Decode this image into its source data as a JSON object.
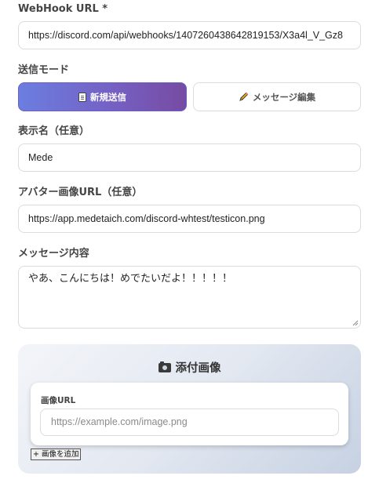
{
  "webhook": {
    "label": "WebHook URL *",
    "value": "https://discord.com/api/webhooks/1407260438642819153/X3a4l_V_Gz8"
  },
  "send_mode": {
    "label": "送信モード",
    "new_send": {
      "icon": "document-icon",
      "label": "新規送信",
      "active": true
    },
    "edit_message": {
      "icon": "pencil-icon",
      "label": "メッセージ編集",
      "active": false
    }
  },
  "display_name": {
    "label": "表示名（任意）",
    "value": "Mede"
  },
  "avatar_url": {
    "label": "アバター画像URL（任意）",
    "value": "https://app.medetaich.com/discord-whtest/testicon.png"
  },
  "message": {
    "label": "メッセージ内容",
    "value": "やあ、こんにちは！めでたいだよ！！！！！"
  },
  "attachments": {
    "title_icon": "camera-icon",
    "title": "添付画像",
    "items": [
      {
        "label": "画像URL",
        "placeholder": "https://example.com/image.png",
        "value": ""
      }
    ],
    "add_button_label": "+ 画像を追加"
  },
  "colors": {
    "accent_start": "#667eea",
    "accent_end": "#764ba2"
  }
}
